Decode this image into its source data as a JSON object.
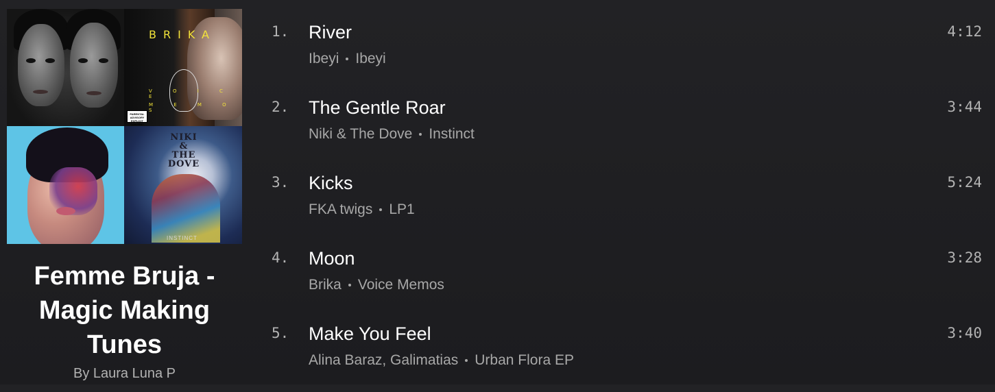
{
  "playlist": {
    "title": "Femme Bruja - Magic Making Tunes",
    "owner": "By Laura Luna P",
    "cover": {
      "tiles": [
        {
          "name": "ibeyi-cover"
        },
        {
          "name": "brika-voice-memos-cover",
          "text": "BRIKA",
          "line1": "V O I C E",
          "line2": "M E M O S",
          "badge": "PARENTAL ADVISORY EXPLICIT CONTENT"
        },
        {
          "name": "fka-twigs-lp1-cover"
        },
        {
          "name": "niki-and-the-dove-instinct-cover",
          "logo": "NIKI & THE DOVE",
          "text": "INSTINCT"
        }
      ]
    }
  },
  "tracks": [
    {
      "num": "1.",
      "title": "River",
      "artist": "Ibeyi",
      "album": "Ibeyi",
      "duration": "4:12"
    },
    {
      "num": "2.",
      "title": "The Gentle Roar",
      "artist": "Niki & The Dove",
      "album": "Instinct",
      "duration": "3:44"
    },
    {
      "num": "3.",
      "title": "Kicks",
      "artist": "FKA twigs",
      "album": "LP1",
      "duration": "5:24"
    },
    {
      "num": "4.",
      "title": "Moon",
      "artist": "Brika",
      "album": "Voice Memos",
      "duration": "3:28"
    },
    {
      "num": "5.",
      "title": "Make You Feel",
      "artist": "Alina Baraz, Galimatias",
      "album": "Urban Flora EP",
      "duration": "3:40"
    }
  ],
  "colors": {
    "background": "#1f1f22",
    "text_primary": "#ffffff",
    "text_secondary": "#b3b3b3"
  }
}
